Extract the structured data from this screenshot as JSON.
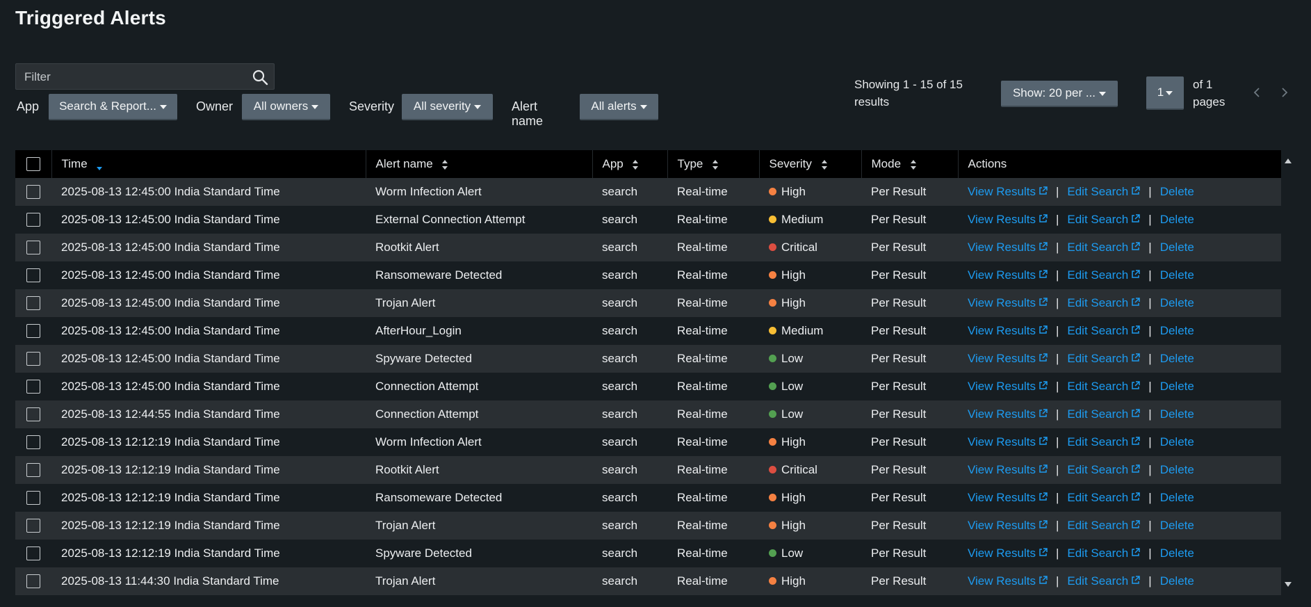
{
  "page": {
    "title": "Triggered Alerts"
  },
  "filter": {
    "placeholder": "Filter"
  },
  "filters": {
    "app_label": "App",
    "app_value": "Search & Report...",
    "owner_label": "Owner",
    "owner_value": "All owners",
    "severity_label": "Severity",
    "severity_value": "All severity",
    "alertname_label": "Alert name",
    "alertname_value": "All alerts"
  },
  "pagination": {
    "showing_text": "Showing 1 - 15 of 15 results",
    "per_page": "Show: 20 per ...",
    "page": "1",
    "of_pages": "of 1 pages"
  },
  "table": {
    "headers": {
      "time": "Time",
      "alert_name": "Alert name",
      "app": "App",
      "type": "Type",
      "severity": "Severity",
      "mode": "Mode",
      "actions": "Actions"
    },
    "actions": {
      "view": "View Results",
      "edit": "Edit Search",
      "delete": "Delete",
      "separator": "|"
    },
    "severity_colors": {
      "High": "#f58142",
      "Medium": "#f8be34",
      "Critical": "#dc4e41",
      "Low": "#53a051"
    },
    "rows": [
      {
        "time": "2025-08-13 12:45:00 India Standard Time",
        "alert_name": "Worm Infection Alert",
        "app": "search",
        "type": "Real-time",
        "severity": "High",
        "mode": "Per Result"
      },
      {
        "time": "2025-08-13 12:45:00 India Standard Time",
        "alert_name": "External Connection Attempt",
        "app": "search",
        "type": "Real-time",
        "severity": "Medium",
        "mode": "Per Result"
      },
      {
        "time": "2025-08-13 12:45:00 India Standard Time",
        "alert_name": "Rootkit Alert",
        "app": "search",
        "type": "Real-time",
        "severity": "Critical",
        "mode": "Per Result"
      },
      {
        "time": "2025-08-13 12:45:00 India Standard Time",
        "alert_name": "Ransomeware Detected",
        "app": "search",
        "type": "Real-time",
        "severity": "High",
        "mode": "Per Result"
      },
      {
        "time": "2025-08-13 12:45:00 India Standard Time",
        "alert_name": "Trojan Alert",
        "app": "search",
        "type": "Real-time",
        "severity": "High",
        "mode": "Per Result"
      },
      {
        "time": "2025-08-13 12:45:00 India Standard Time",
        "alert_name": "AfterHour_Login",
        "app": "search",
        "type": "Real-time",
        "severity": "Medium",
        "mode": "Per Result"
      },
      {
        "time": "2025-08-13 12:45:00 India Standard Time",
        "alert_name": "Spyware Detected",
        "app": "search",
        "type": "Real-time",
        "severity": "Low",
        "mode": "Per Result"
      },
      {
        "time": "2025-08-13 12:45:00 India Standard Time",
        "alert_name": "Connection Attempt",
        "app": "search",
        "type": "Real-time",
        "severity": "Low",
        "mode": "Per Result"
      },
      {
        "time": "2025-08-13 12:44:55 India Standard Time",
        "alert_name": "Connection Attempt",
        "app": "search",
        "type": "Real-time",
        "severity": "Low",
        "mode": "Per Result"
      },
      {
        "time": "2025-08-13 12:12:19 India Standard Time",
        "alert_name": "Worm Infection Alert",
        "app": "search",
        "type": "Real-time",
        "severity": "High",
        "mode": "Per Result"
      },
      {
        "time": "2025-08-13 12:12:19 India Standard Time",
        "alert_name": "Rootkit Alert",
        "app": "search",
        "type": "Real-time",
        "severity": "Critical",
        "mode": "Per Result"
      },
      {
        "time": "2025-08-13 12:12:19 India Standard Time",
        "alert_name": "Ransomeware Detected",
        "app": "search",
        "type": "Real-time",
        "severity": "High",
        "mode": "Per Result"
      },
      {
        "time": "2025-08-13 12:12:19 India Standard Time",
        "alert_name": "Trojan Alert",
        "app": "search",
        "type": "Real-time",
        "severity": "High",
        "mode": "Per Result"
      },
      {
        "time": "2025-08-13 12:12:19 India Standard Time",
        "alert_name": "Spyware Detected",
        "app": "search",
        "type": "Real-time",
        "severity": "Low",
        "mode": "Per Result"
      },
      {
        "time": "2025-08-13 11:44:30 India Standard Time",
        "alert_name": "Trojan Alert",
        "app": "search",
        "type": "Real-time",
        "severity": "High",
        "mode": "Per Result"
      }
    ]
  },
  "icons": {
    "search": "search-icon",
    "sort": "sort-icon",
    "sort_desc": "sort-desc-icon",
    "external_link": "external-link-icon",
    "prev": "chevron-left-icon",
    "next": "chevron-right-icon"
  }
}
